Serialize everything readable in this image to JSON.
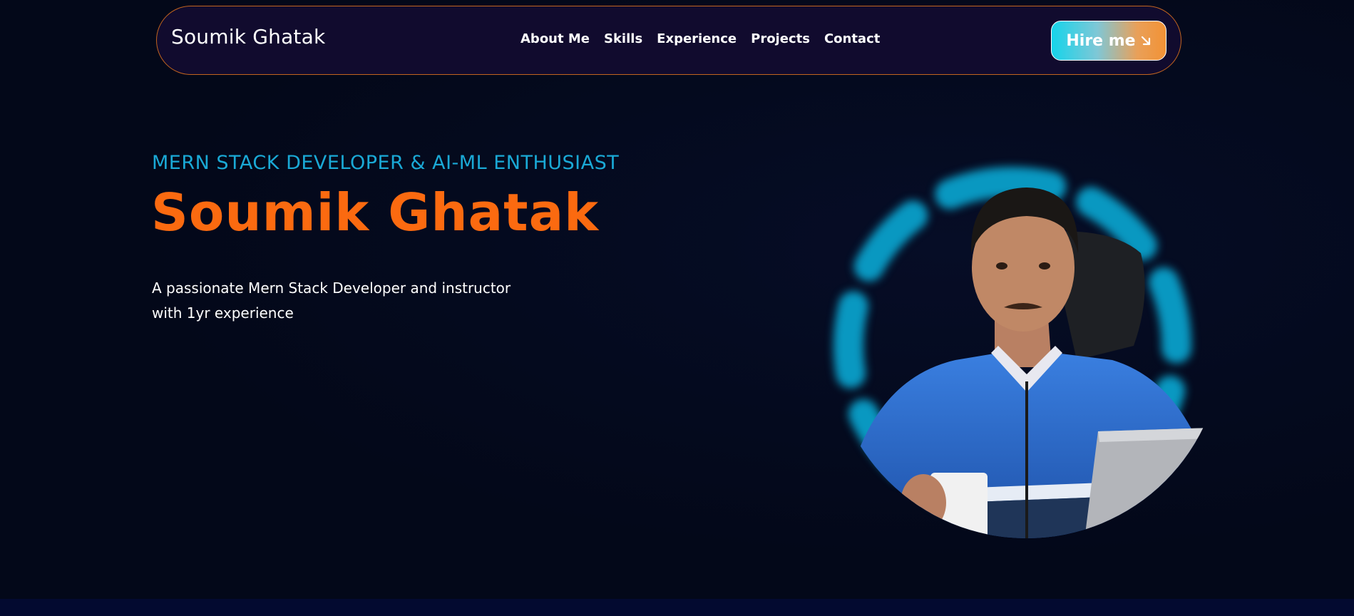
{
  "navbar": {
    "brand": "Soumik Ghatak",
    "links": [
      "About Me",
      "Skills",
      "Experience",
      "Projects",
      "Contact"
    ],
    "cta_label": "Hire me",
    "cta_icon": "arrow-down-right-icon"
  },
  "hero": {
    "subtitle": "MERN STACK DEVELOPER & AI-ML ENTHUSIAST",
    "title": "Soumik Ghatak",
    "description_line1": "A passionate Mern Stack Developer and instructor",
    "description_line2": "with 1yr experience"
  },
  "colors": {
    "background": "#030819",
    "navbar_bg": "#110b2e",
    "navbar_border": "#c2641f",
    "accent_cyan": "#1aa9d6",
    "accent_orange": "#fb6a10",
    "button_gradient_start": "#16d4ea",
    "button_gradient_end": "#f29235",
    "ring_glow": "#0aa7d3",
    "jacket_blue": "#2f6fd0"
  },
  "portrait": {
    "icon": "profile-photo"
  }
}
